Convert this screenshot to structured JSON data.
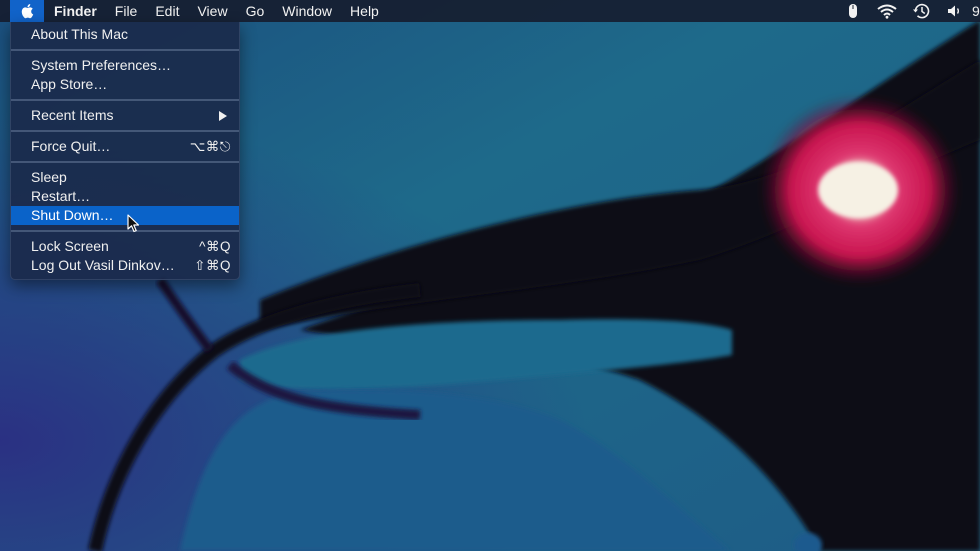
{
  "desktop": {
    "wallpaper": "abstract blue shapes with black bands and glowing magenta orb",
    "colors": {
      "blue_teal": "#1e6b8c",
      "deep_blue": "#233a7a",
      "violet_edge": "#2b1f6a",
      "black_band": "#0a0812",
      "magenta_glow": "#d41d5a",
      "white_core": "#f4f0e6"
    }
  },
  "menubar": {
    "apple_icon": "apple-logo-icon",
    "app_name": "Finder",
    "items": [
      "File",
      "Edit",
      "View",
      "Go",
      "Window",
      "Help"
    ],
    "status_icons": [
      "mouse-battery-icon",
      "wifi-icon",
      "time-machine-icon",
      "volume-icon"
    ],
    "clock_partial": "9"
  },
  "apple_menu": {
    "groups": [
      [
        {
          "label": "About This Mac",
          "shortcut": ""
        }
      ],
      [
        {
          "label": "System Preferences…",
          "shortcut": ""
        },
        {
          "label": "App Store…",
          "shortcut": ""
        }
      ],
      [
        {
          "label": "Recent Items",
          "shortcut": "",
          "submenu": true
        }
      ],
      [
        {
          "label": "Force Quit…",
          "shortcut": "⌥⌘⎋"
        }
      ],
      [
        {
          "label": "Sleep",
          "shortcut": ""
        },
        {
          "label": "Restart…",
          "shortcut": ""
        },
        {
          "label": "Shut Down…",
          "shortcut": "",
          "highlighted": true
        }
      ],
      [
        {
          "label": "Lock Screen",
          "shortcut": "^⌘Q"
        },
        {
          "label": "Log Out Vasil Dinkov…",
          "shortcut": "⇧⌘Q"
        }
      ]
    ],
    "highlight_color": "#0a63c9"
  }
}
